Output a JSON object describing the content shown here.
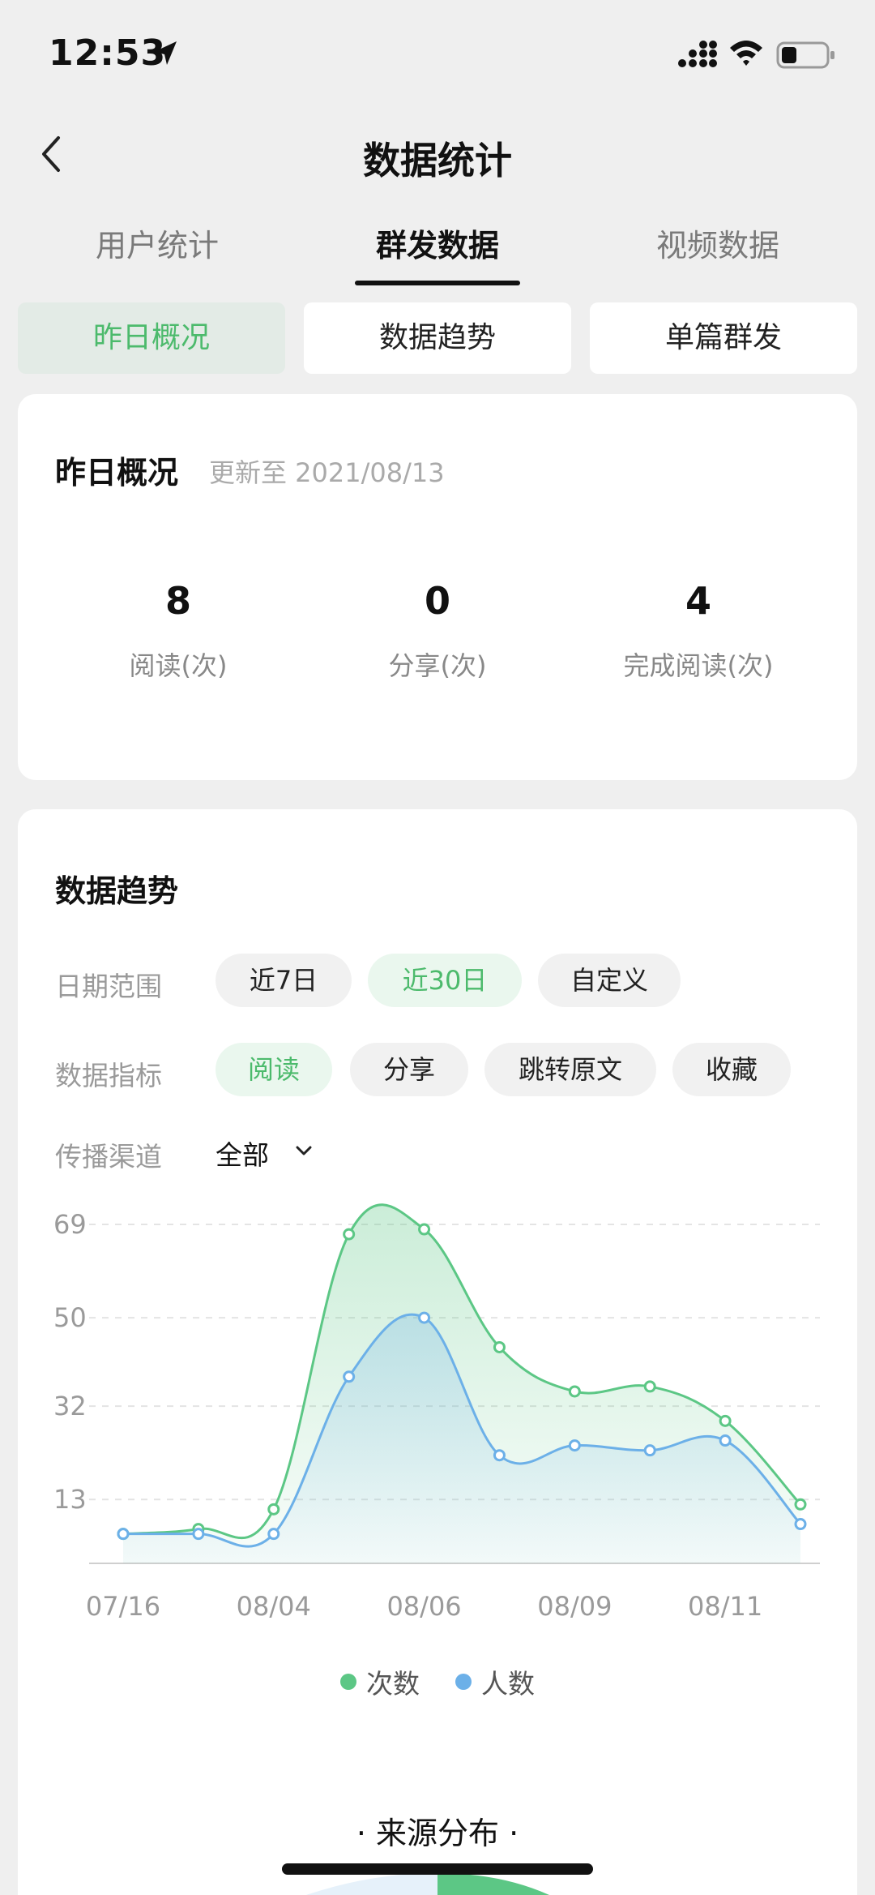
{
  "status_bar": {
    "time": "12:53"
  },
  "nav": {
    "title": "数据统计"
  },
  "main_tabs": [
    {
      "label": "用户统计",
      "active": false
    },
    {
      "label": "群发数据",
      "active": true
    },
    {
      "label": "视频数据",
      "active": false
    }
  ],
  "sub_tabs": [
    {
      "label": "昨日概况",
      "active": true
    },
    {
      "label": "数据趋势",
      "active": false
    },
    {
      "label": "单篇群发",
      "active": false
    }
  ],
  "overview": {
    "title": "昨日概况",
    "update": "更新至 2021/08/13",
    "stats": [
      {
        "value": "8",
        "label": "阅读(次)"
      },
      {
        "value": "0",
        "label": "分享(次)"
      },
      {
        "value": "4",
        "label": "完成阅读(次)"
      }
    ]
  },
  "trend": {
    "title": "数据趋势",
    "date_range_label": "日期范围",
    "date_options": [
      {
        "label": "近7日",
        "active": false
      },
      {
        "label": "近30日",
        "active": true
      },
      {
        "label": "自定义",
        "active": false
      }
    ],
    "metric_label": "数据指标",
    "metric_options": [
      {
        "label": "阅读",
        "active": true
      },
      {
        "label": "分享",
        "active": false
      },
      {
        "label": "跳转原文",
        "active": false
      },
      {
        "label": "收藏",
        "active": false
      }
    ],
    "channel_label": "传播渠道",
    "channel_value": "全部",
    "legend": {
      "count": "次数",
      "people": "人数"
    },
    "source_title": "· 来源分布 ·"
  },
  "colors": {
    "accent_green": "#4cba6c",
    "series_green": "#5cc785",
    "series_blue": "#6cb0e8",
    "bg": "#efefef"
  },
  "chart_data": {
    "type": "area",
    "ylim": [
      0,
      69
    ],
    "y_ticks": [
      "13",
      "32",
      "50",
      "69"
    ],
    "x_tick_labels": [
      "07/16",
      "08/04",
      "08/06",
      "08/09",
      "08/11"
    ],
    "x": [
      0,
      1,
      2,
      3,
      4,
      5,
      6,
      7,
      8,
      9
    ],
    "series": [
      {
        "name": "次数",
        "color": "#5cc785",
        "values": [
          6,
          7,
          11,
          67,
          68,
          44,
          35,
          36,
          29,
          12
        ]
      },
      {
        "name": "人数",
        "color": "#6cb0e8",
        "values": [
          6,
          6,
          6,
          38,
          50,
          22,
          24,
          23,
          25,
          8
        ]
      }
    ],
    "grid": true,
    "legend_position": "bottom"
  }
}
